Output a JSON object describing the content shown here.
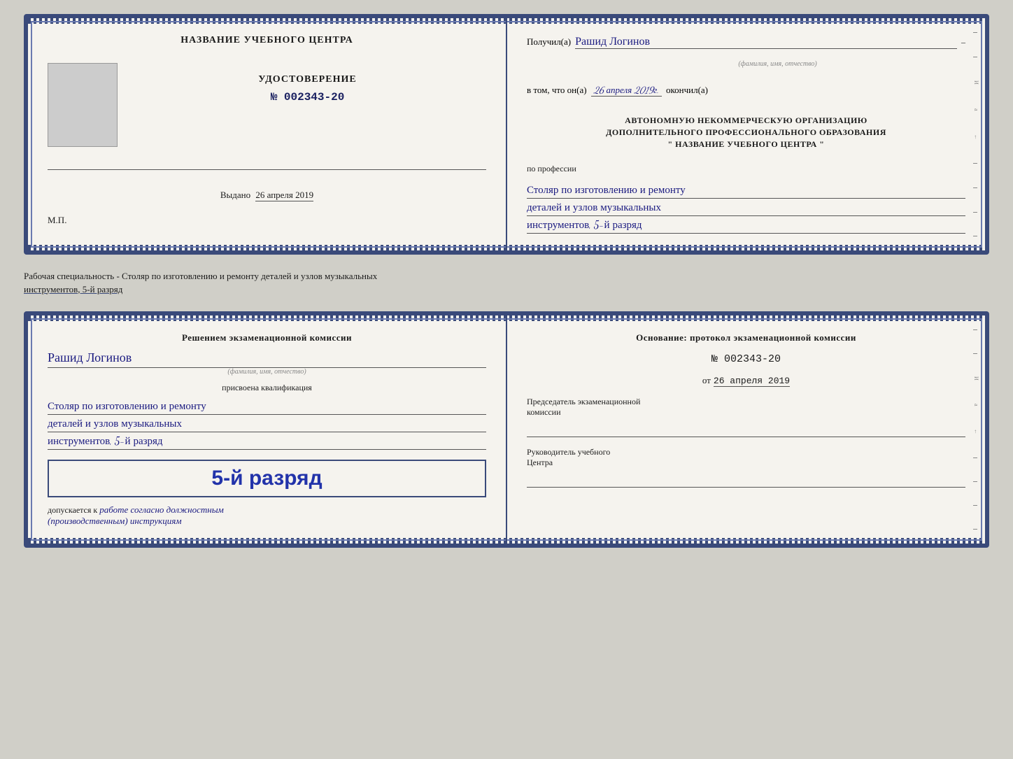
{
  "top_cert": {
    "left": {
      "center_name": "НАЗВАНИЕ УЧЕБНОГО ЦЕНТРА",
      "udost_title": "УДОСТОВЕРЕНИЕ",
      "number": "№ 002343-20",
      "vydano_label": "Выдано",
      "vydano_date": "26 апреля 2019",
      "mp_label": "М.П."
    },
    "right": {
      "poluchil_label": "Получил(a)",
      "person_name": "Рашид Логинов",
      "fio_hint": "(фамилия, имя, отчество)",
      "vtom_label": "в том, что он(а)",
      "date_value": "26 апреля 2019г.",
      "okonchil_label": "окончил(а)",
      "org_text_1": "АВТОНОМНУЮ НЕКОММЕРЧЕСКУЮ ОРГАНИЗАЦИЮ",
      "org_text_2": "ДОПОЛНИТЕЛЬНОГО ПРОФЕССИОНАЛЬНОГО ОБРАЗОВАНИЯ",
      "org_text_3": "\"  НАЗВАНИЕ УЧЕБНОГО ЦЕНТРА  \"",
      "po_professii_label": "по профессии",
      "profession_line1": "Столяр по изготовлению и ремонту",
      "profession_line2": "деталей и узлов музыкальных",
      "profession_line3": "инструментов, 5-й разряд"
    }
  },
  "middle_text": {
    "text": "Рабочая специальность - Столяр по изготовлению и ремонту деталей и узлов музыкальных",
    "text2": "инструментов, 5-й разряд"
  },
  "bottom_cert": {
    "left": {
      "decision_text": "Решением экзаменационной комиссии",
      "person_name": "Рашид Логинов",
      "fio_hint": "(фамилия, имя, отчество)",
      "prisvoena_label": "присвоена квалификация",
      "prof_line1": "Столяр по изготовлению и ремонту",
      "prof_line2": "деталей и узлов музыкальных",
      "prof_line3": "инструментов, 5-й разряд",
      "rank_text": "5-й разряд",
      "dopuskaetsya_label": "допускается к",
      "dopusk_value": "работе согласно должностным",
      "dopusk_value2": "(производственным) инструкциям"
    },
    "right": {
      "osnovanie_text": "Основание: протокол экзаменационной комиссии",
      "number_label": "№",
      "number_value": "002343-20",
      "ot_label": "от",
      "date_value": "26 апреля 2019",
      "predsedatel_label": "Председатель экзаменационной",
      "predsedatel_label2": "комиссии",
      "rukovoditel_label": "Руководитель учебного",
      "rukovoditel_label2": "Центра"
    }
  }
}
